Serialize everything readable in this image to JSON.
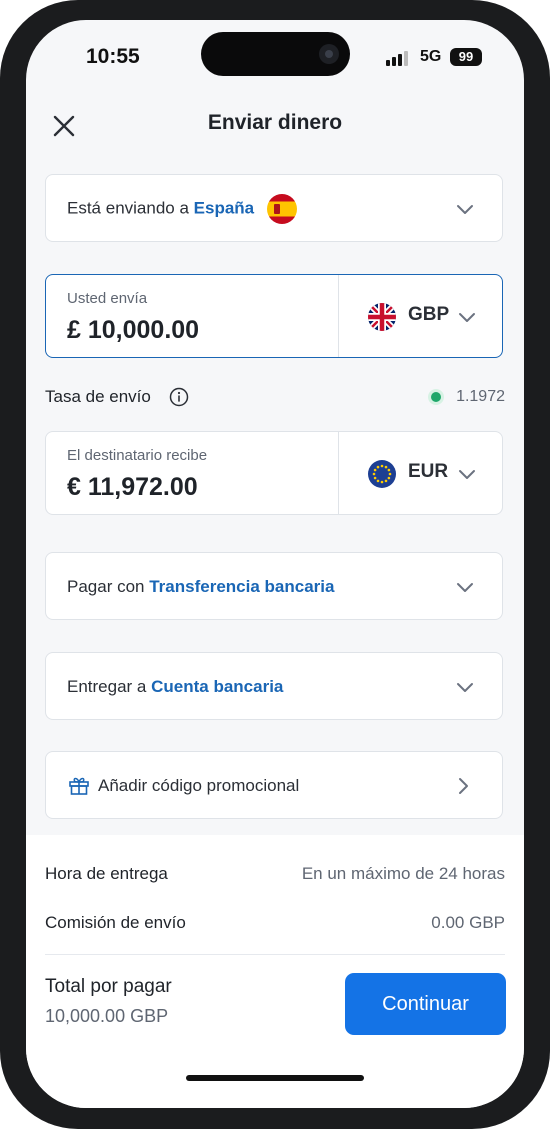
{
  "status_bar": {
    "time": "10:55",
    "network": "5G",
    "battery": "99"
  },
  "header": {
    "title": "Enviar dinero"
  },
  "destination": {
    "prefix": "Está enviando a",
    "country": "España"
  },
  "send": {
    "label": "Usted envía",
    "amount": "£ 10,000.00",
    "currency": "GBP"
  },
  "rate": {
    "label": "Tasa de envío",
    "value": "1.1972"
  },
  "receive": {
    "label": "El destinatario recibe",
    "amount": "€ 11,972.00",
    "currency": "EUR"
  },
  "pay_with": {
    "prefix": "Pagar con",
    "value": "Transferencia bancaria"
  },
  "deliver_to": {
    "prefix": "Entregar a",
    "value": "Cuenta bancaria"
  },
  "promo": {
    "label": "Añadir código promocional"
  },
  "summary": {
    "delivery_label": "Hora de entrega",
    "delivery_value": "En un máximo de 24 horas",
    "fee_label": "Comisión de envío",
    "fee_value": "0.00 GBP",
    "total_label": "Total por pagar",
    "total_value": "10,000.00 GBP",
    "continue_label": "Continuar"
  },
  "colors": {
    "accent": "#1473e6",
    "link": "#1a66b5",
    "rate_dot": "#1ea76a"
  }
}
